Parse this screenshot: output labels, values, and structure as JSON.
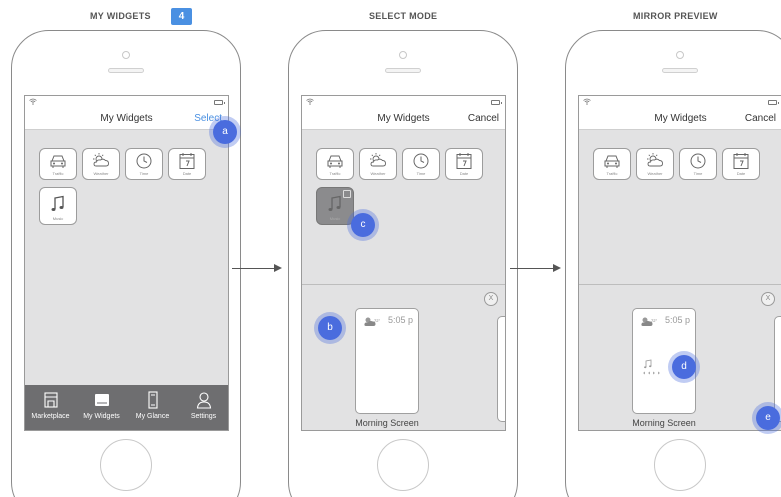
{
  "columns": [
    {
      "title": "MY WIDGETS",
      "badge": "4"
    },
    {
      "title": "SELECT MODE"
    },
    {
      "title": "MIRROR PREVIEW"
    }
  ],
  "screen1": {
    "title": "My Widgets",
    "action": "Select",
    "widgets": [
      "Traffic",
      "Weather",
      "Time",
      "Date",
      "Music"
    ],
    "tabs": [
      "Marketplace",
      "My Widgets",
      "My Glance",
      "Settings"
    ]
  },
  "screen2": {
    "title": "My Widgets",
    "action": "Cancel",
    "widgets": [
      "Traffic",
      "Weather",
      "Time",
      "Date"
    ],
    "selected_widget": "Music",
    "card_time": "5:05 p",
    "card_temp": "72°",
    "card_caption": "Morning Screen",
    "close": "X"
  },
  "screen3": {
    "title": "My Widgets",
    "action": "Cancel",
    "widgets": [
      "Traffic",
      "Weather",
      "Time",
      "Date"
    ],
    "card_time": "5:05 p",
    "card_temp": "72°",
    "card_caption": "Morning Screen",
    "close": "X"
  },
  "markers": {
    "a": "a",
    "b": "b",
    "c": "c",
    "d": "d",
    "e": "e"
  },
  "colors": {
    "accent": "#4a90e2",
    "marker": "#4a6cde",
    "tabbar": "#6e6e70",
    "screen_bg": "#e2e2e3"
  }
}
